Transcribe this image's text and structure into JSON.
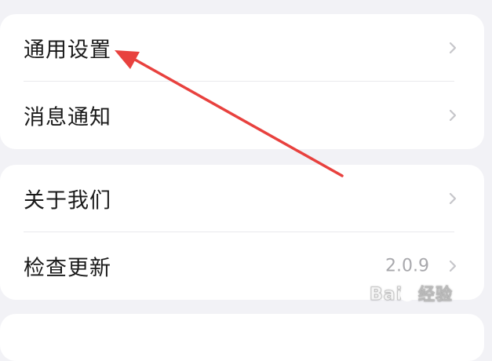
{
  "settings_group_1": {
    "items": [
      {
        "label": "通用设置"
      },
      {
        "label": "消息通知"
      }
    ]
  },
  "settings_group_2": {
    "items": [
      {
        "label": "关于我们"
      },
      {
        "label": "检查更新",
        "value": "2.0.9"
      }
    ]
  },
  "annotation": {
    "color": "#e8413e",
    "target": "通用设置"
  },
  "watermark": {
    "text": "Bai 经验",
    "logo": "baidu-paw-logo"
  },
  "icons": {
    "chevron": "chevron-right-icon"
  }
}
